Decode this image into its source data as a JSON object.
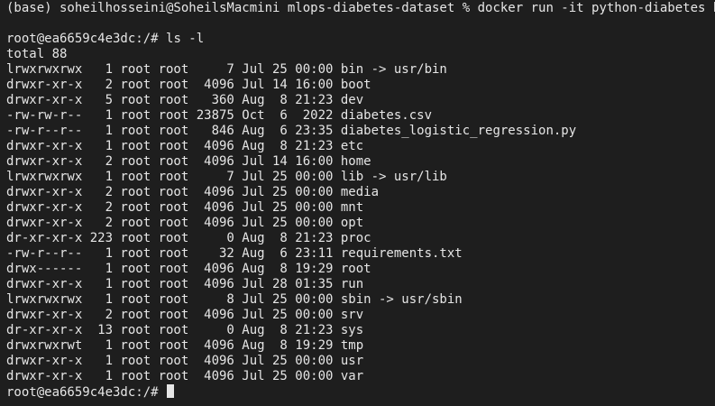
{
  "terminal": {
    "first_command": "(base) soheilhosseini@SoheilsMacmini mlops-diabetes-dataset % docker run -it python-diabetes bash",
    "prompt": "root@ea6659c4e3dc:/# ",
    "command": "ls -l",
    "total": "total 88",
    "listing": [
      {
        "text": "lrwxrwxrwx   1 root root     7 Jul 25 00:00 bin -> usr/bin"
      },
      {
        "text": "drwxr-xr-x   2 root root  4096 Jul 14 16:00 boot"
      },
      {
        "text": "drwxr-xr-x   5 root root   360 Aug  8 21:23 dev"
      },
      {
        "text": "-rw-rw-r--   1 root root 23875 Oct  6  2022 diabetes.csv"
      },
      {
        "text": "-rw-r--r--   1 root root   846 Aug  6 23:35 diabetes_logistic_regression.py"
      },
      {
        "text": "drwxr-xr-x   1 root root  4096 Aug  8 21:23 etc"
      },
      {
        "text": "drwxr-xr-x   2 root root  4096 Jul 14 16:00 home"
      },
      {
        "text": "lrwxrwxrwx   1 root root     7 Jul 25 00:00 lib -> usr/lib"
      },
      {
        "text": "drwxr-xr-x   2 root root  4096 Jul 25 00:00 media"
      },
      {
        "text": "drwxr-xr-x   2 root root  4096 Jul 25 00:00 mnt"
      },
      {
        "text": "drwxr-xr-x   2 root root  4096 Jul 25 00:00 opt"
      },
      {
        "text": "dr-xr-xr-x 223 root root     0 Aug  8 21:23 proc"
      },
      {
        "text": "-rw-r--r--   1 root root    32 Aug  6 23:11 requirements.txt"
      },
      {
        "text": "drwx------   1 root root  4096 Aug  8 19:29 root"
      },
      {
        "text": "drwxr-xr-x   1 root root  4096 Jul 28 01:35 run"
      },
      {
        "text": "lrwxrwxrwx   1 root root     8 Jul 25 00:00 sbin -> usr/sbin"
      },
      {
        "text": "drwxr-xr-x   2 root root  4096 Jul 25 00:00 srv"
      },
      {
        "text": "dr-xr-xr-x  13 root root     0 Aug  8 21:23 sys"
      },
      {
        "text": "drwxrwxrwt   1 root root  4096 Aug  8 19:29 tmp"
      },
      {
        "text": "drwxr-xr-x   1 root root  4096 Jul 25 00:00 usr"
      },
      {
        "text": "drwxr-xr-x   1 root root  4096 Jul 25 00:00 var"
      }
    ]
  },
  "colors": {
    "background": "#1e1e1e",
    "text": "#e6e6e6"
  }
}
